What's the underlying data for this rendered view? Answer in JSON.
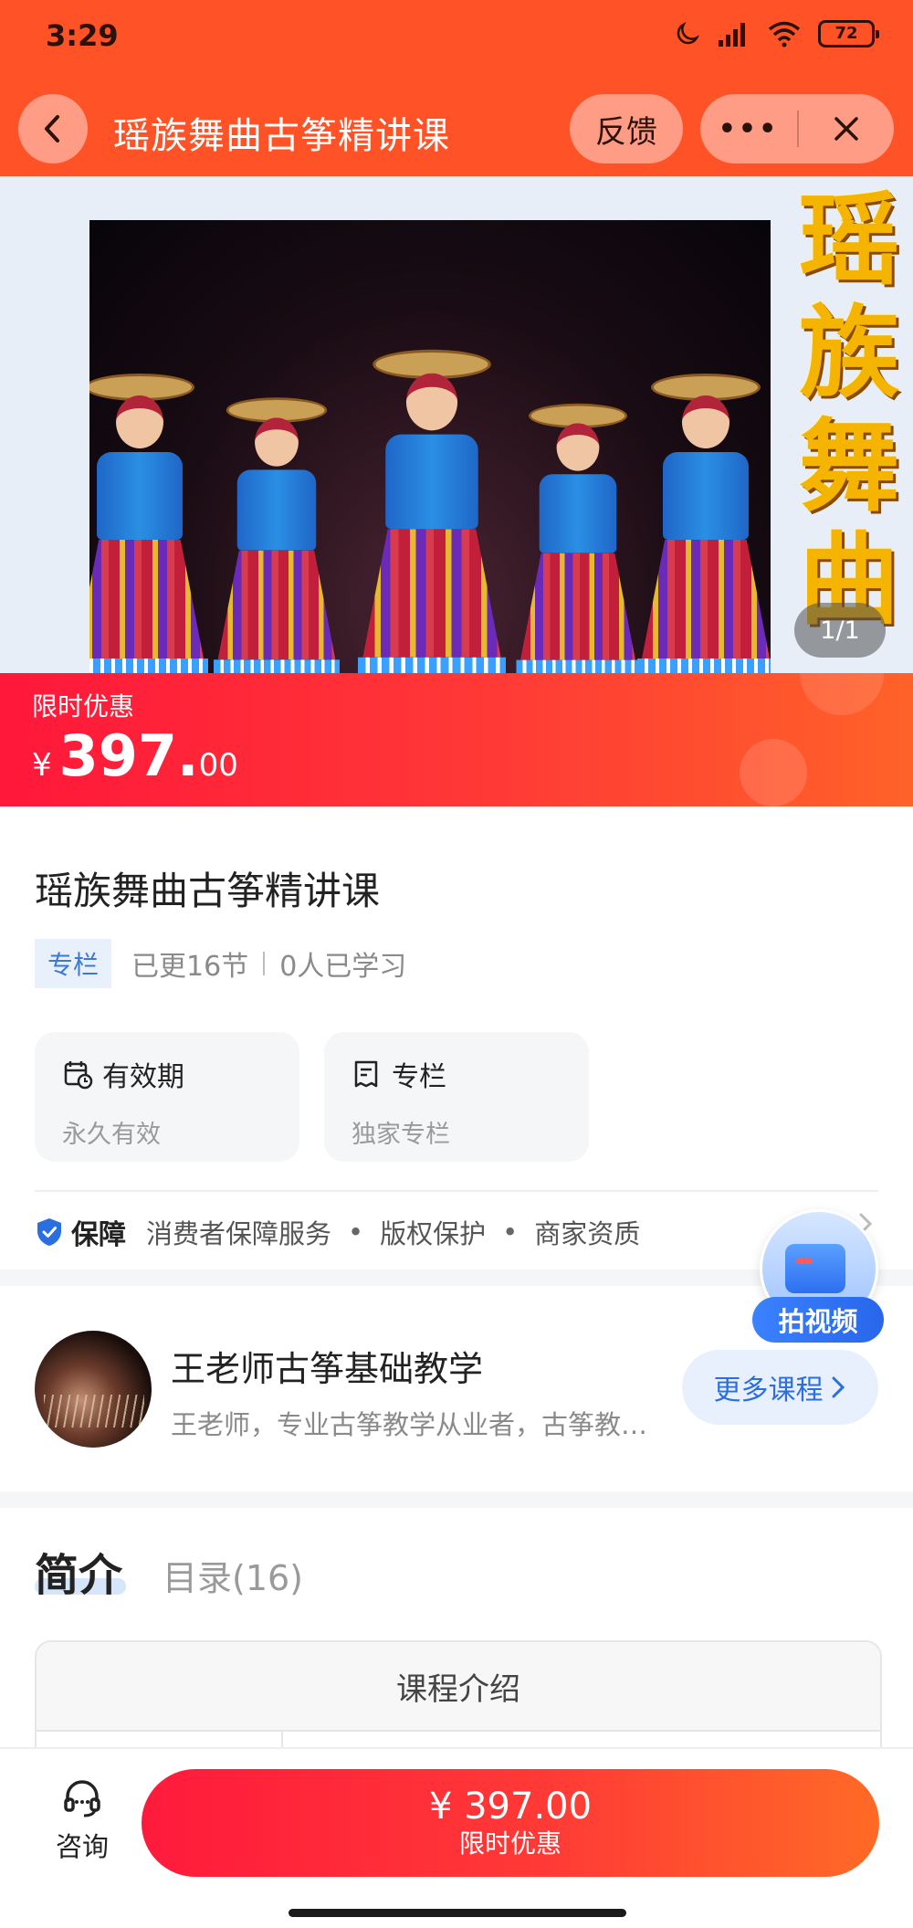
{
  "status_bar": {
    "time": "3:29",
    "battery": "72",
    "icons": [
      "moon-icon",
      "signal-icon",
      "wifi-icon",
      "battery-icon"
    ]
  },
  "nav": {
    "title": "瑶族舞曲古筝精讲课",
    "feedback_label": "反馈",
    "more_label": "•••"
  },
  "banner": {
    "vertical_title": [
      "瑶",
      "族",
      "舞",
      "曲"
    ],
    "counter": "1/1"
  },
  "price_bar": {
    "label": "限时优惠",
    "currency": "¥",
    "price_int": "397.",
    "price_dec": "00"
  },
  "course": {
    "title": "瑶族舞曲古筝精讲课",
    "tag": "专栏",
    "updated": "已更16节",
    "learners": "0人已学习",
    "cards": [
      {
        "title": "有效期",
        "sub": "永久有效",
        "icon": "calendar-clock-icon"
      },
      {
        "title": "专栏",
        "sub": "独家专栏",
        "icon": "receipt-icon"
      }
    ],
    "guarantee": {
      "title": "保障",
      "items": [
        "消费者保障服务",
        "版权保护",
        "商家资质"
      ]
    }
  },
  "fab": {
    "label": "拍视频"
  },
  "teacher": {
    "name": "王老师古筝基础教学",
    "desc": "王老师，专业古筝教学从业者，古筝教学经验丰富",
    "more_label": "更多课程"
  },
  "tabs": {
    "active": "简介",
    "inactive": "目录(16)"
  },
  "intro": {
    "header": "课程介绍"
  },
  "bottom": {
    "consult_label": "咨询",
    "buy_price": "¥ 397.00",
    "buy_sub": "限时优惠"
  },
  "colors": {
    "header": "#ff5227",
    "price_gradient_start": "#ff173a",
    "price_gradient_end": "#ff6228",
    "accent_blue": "#2a6ee0"
  }
}
